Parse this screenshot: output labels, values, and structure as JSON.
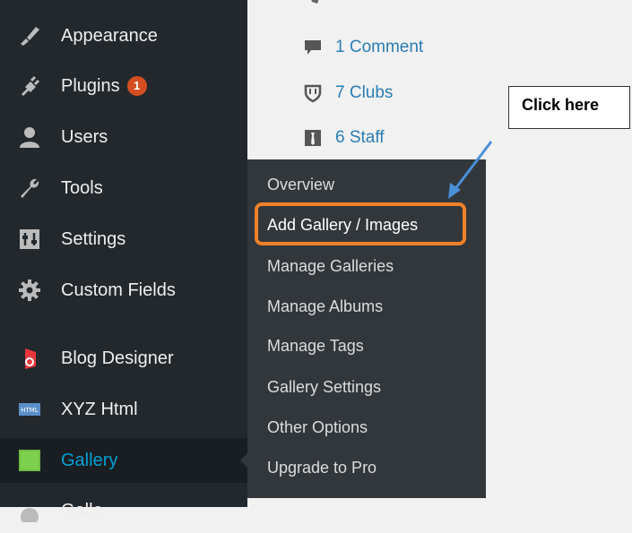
{
  "sidebar": {
    "items": [
      {
        "label": "Appearance",
        "icon": "paintbrush-icon"
      },
      {
        "label": "Plugins",
        "icon": "plug-icon",
        "badge": "1"
      },
      {
        "label": "Users",
        "icon": "users-icon"
      },
      {
        "label": "Tools",
        "icon": "wrench-icon"
      },
      {
        "label": "Settings",
        "icon": "settings-icon"
      },
      {
        "label": "Custom Fields",
        "icon": "gear-icon"
      },
      {
        "label": "Blog Designer",
        "icon": "blog-designer-icon"
      },
      {
        "label": "XYZ Html",
        "icon": "html-icon"
      },
      {
        "label": "Gallery",
        "icon": "gallery-icon"
      },
      {
        "label": "Galle",
        "icon": "circle-icon"
      }
    ],
    "active_color": "#00a0d2"
  },
  "content": {
    "items": [
      {
        "label": "1 Comment",
        "icon": "comment-icon"
      },
      {
        "label": "7 Clubs",
        "icon": "shield-icon"
      },
      {
        "label": "6 Staff",
        "icon": "staff-icon"
      }
    ]
  },
  "submenu": {
    "items": [
      {
        "label": "Overview"
      },
      {
        "label": "Add Gallery / Images"
      },
      {
        "label": "Manage Galleries"
      },
      {
        "label": "Manage Albums"
      },
      {
        "label": "Manage Tags"
      },
      {
        "label": "Gallery Settings"
      },
      {
        "label": "Other Options"
      },
      {
        "label": "Upgrade to Pro"
      }
    ]
  },
  "callout": {
    "text": "Click here"
  },
  "colors": {
    "sidebar_bg": "#23282d",
    "submenu_bg": "#32373c",
    "highlight": "#f0812a",
    "arrow": "#4a90d9"
  }
}
